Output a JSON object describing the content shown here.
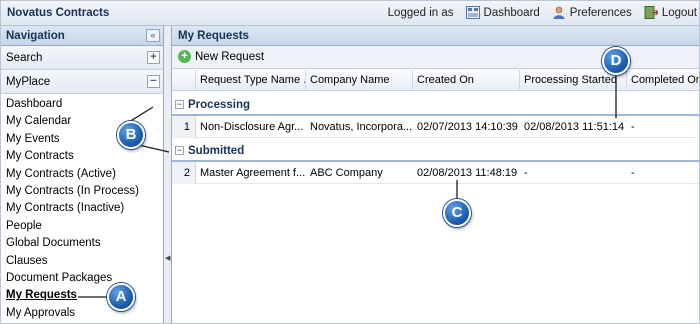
{
  "app": {
    "title": "Novatus Contracts"
  },
  "topnav": {
    "logged_in": "Logged in as",
    "dashboard": "Dashboard",
    "preferences": "Preferences",
    "logout": "Logout"
  },
  "nav": {
    "header": "Navigation",
    "collapse_glyph": "«",
    "search": "Search",
    "myplace": "MyPlace",
    "items": [
      "Dashboard",
      "My Calendar",
      "My Events",
      "My Contracts",
      "My Contracts (Active)",
      "My Contracts (In Process)",
      "My Contracts (Inactive)",
      "People",
      "Global Documents",
      "Clauses",
      "Document Packages",
      "My Requests",
      "My Approvals"
    ],
    "active_item": "My Requests"
  },
  "main": {
    "title": "My Requests",
    "new_request": "New Request",
    "columns": [
      "Request Type Name",
      "Company Name",
      "Created On",
      "Processing Started",
      "Completed On"
    ],
    "groups": [
      {
        "label": "Processing",
        "rows": [
          {
            "num": "1",
            "type": "Non-Disclosure Agr...",
            "company": "Novatus, Incorpora...",
            "created": "02/07/2013 14:10:39",
            "started": "02/08/2013 11:51:14",
            "completed": "-"
          }
        ]
      },
      {
        "label": "Submitted",
        "rows": [
          {
            "num": "2",
            "type": "Master Agreement f...",
            "company": "ABC Company",
            "created": "02/08/2013 11:48:19",
            "started": "-",
            "completed": "-"
          }
        ]
      }
    ]
  },
  "callouts": [
    "A",
    "B",
    "C",
    "D"
  ],
  "colors": {
    "header_text": "#15325a",
    "callout": "#1e5fb0",
    "new_icon": "#5ab552"
  }
}
